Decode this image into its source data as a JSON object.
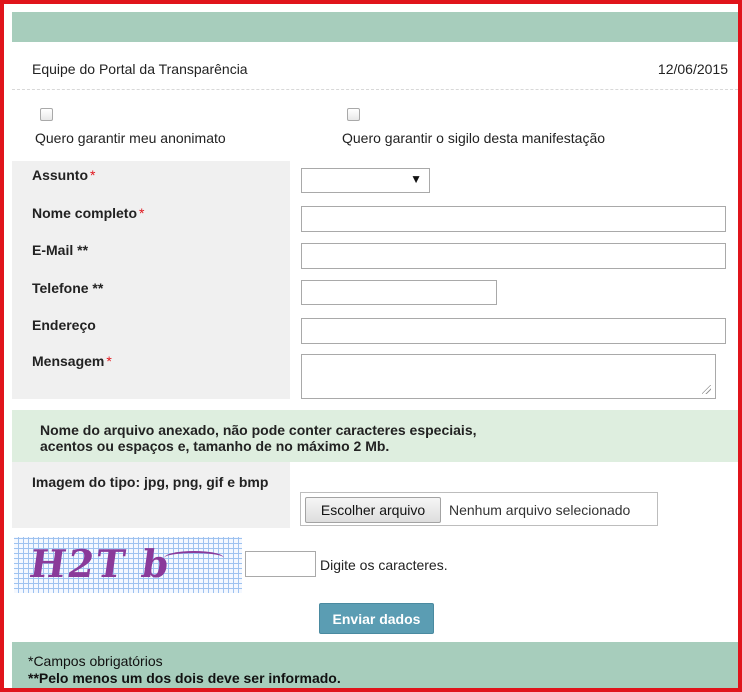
{
  "header": {
    "team_name": "Equipe do Portal da Transparência",
    "date": "12/06/2015"
  },
  "options": {
    "anonymity_label": "Quero garantir meu anonimato",
    "anonymity_checked": false,
    "secrecy_label": "Quero garantir o sigilo desta manifestação",
    "secrecy_checked": false
  },
  "form": {
    "required_mark": "*",
    "subject": {
      "label": "Assunto",
      "value": ""
    },
    "full_name": {
      "label": "Nome completo",
      "value": ""
    },
    "email": {
      "label": "E-Mail **",
      "value": ""
    },
    "phone": {
      "label": "Telefone **",
      "value": ""
    },
    "address": {
      "label": "Endereço",
      "value": ""
    },
    "message": {
      "label": "Mensagem",
      "value": ""
    }
  },
  "attachment": {
    "note_line1": "Nome do arquivo anexado, não pode conter caracteres especiais,",
    "note_line2": "acentos ou espaços e, tamanho de no máximo 2 Mb.",
    "type_label": "Imagem do tipo: jpg, png, gif e bmp",
    "choose_button": "Escolher arquivo",
    "status": "Nenhum arquivo selecionado"
  },
  "captcha": {
    "image_text": "H2T b",
    "input_value": "",
    "hint": "Digite os caracteres."
  },
  "submit_label": "Enviar dados",
  "footer": {
    "line1": "*Campos obrigatórios",
    "line2": "**Pelo menos um dos dois deve ser informado."
  },
  "colors": {
    "frame_border": "#e0141b",
    "bar": "#a7cdbc",
    "note_background": "#deeedf",
    "submit_button": "#5b9db3"
  }
}
